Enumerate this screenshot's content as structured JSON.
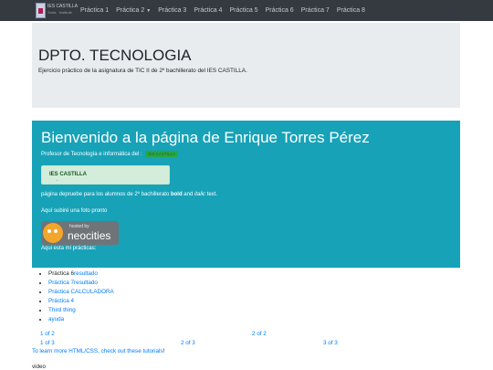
{
  "navbar": {
    "brand_line1": "IES CASTILLA",
    "brand_line2": "Soria · Institute",
    "items": [
      {
        "label": "Práctica 1"
      },
      {
        "label": "Práctica 2",
        "dropdown": true
      },
      {
        "label": "Práctica 3"
      },
      {
        "label": "Práctica 4"
      },
      {
        "label": "Práctica 5"
      },
      {
        "label": "Práctica 6"
      },
      {
        "label": "Práctica 7"
      },
      {
        "label": "Práctica 8"
      }
    ]
  },
  "jumbotron": {
    "title": "DPTO. TECNOLOGIA",
    "subtitle": "Ejercicio práctico de la asignatura de TIC II de 2º bachillerato del IES CASTILLA."
  },
  "welcome": {
    "title": "Bienvenido a la página de Enrique Torres Pérez",
    "subtitle": "Profesor de Tecnología e informática del :",
    "badge": "IES CASTILLA",
    "alert_text": "IES CASTILLA",
    "alert_suffix": ".",
    "line1_pre": "página depruebe para los alumnos de 2º bachillerato ",
    "line1_bold": "bold",
    "line1_mid": " and ",
    "line1_italic": "italic",
    "line1_post": " text.",
    "line2": "Aquí subiré una foto pronto",
    "neocities_small": "hosted by",
    "neocities_big": "neocities",
    "practicas_label": "Aqui esta mi prácticas:"
  },
  "practice_list": [
    {
      "text": "Práctica 6",
      "link": "resultado"
    },
    {
      "text": "Práctica 7",
      "link": "resultado"
    },
    {
      "text": "Práctica CALCULADORA",
      "link": ""
    },
    {
      "text": "Práctica 4",
      "link": ""
    },
    {
      "text": "Third thing",
      "link": ""
    },
    {
      "text": "ayuda",
      "link": ""
    }
  ],
  "pagination_a": [
    "1 of 2",
    "2 of 2"
  ],
  "pagination_b": [
    "1 of 3",
    "2 of 3",
    "3 of 3"
  ],
  "footer": {
    "tutorial_pre": "To learn more HTML/CSS, check out these ",
    "tutorial_link": "tutorials",
    "tutorial_post": "!",
    "video": "video"
  },
  "colors": {
    "navbar": "#343a40",
    "jumbotron": "#e9ecef",
    "info": "#17a2b8",
    "badge": "#28a745",
    "alert": "#d4edda",
    "link": "#007bff"
  }
}
